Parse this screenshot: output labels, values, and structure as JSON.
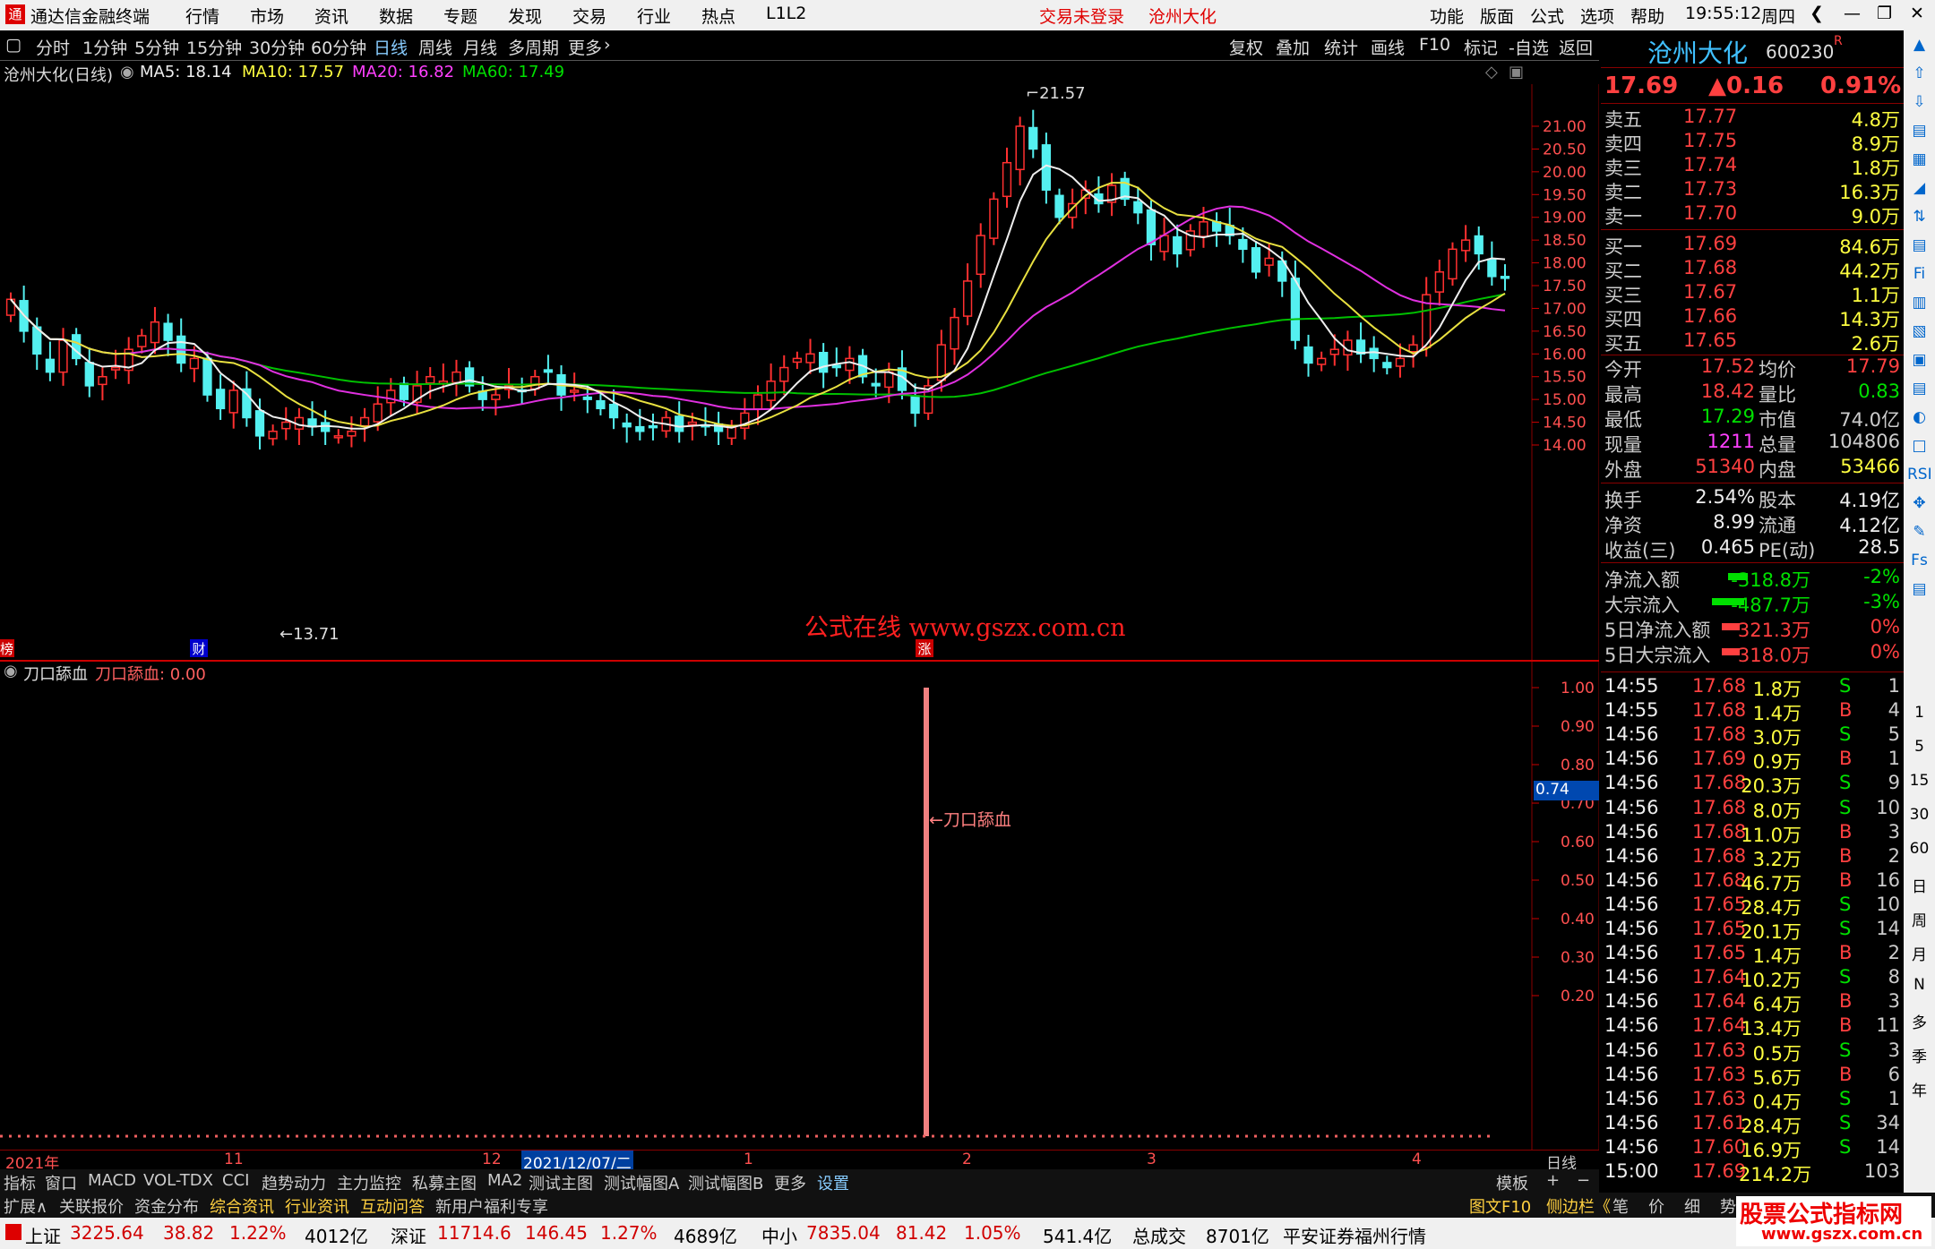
{
  "titlebar": {
    "app": "通达信金融终端",
    "menu": [
      "行情",
      "市场",
      "资讯",
      "数据",
      "专题",
      "发现",
      "交易",
      "行业",
      "热点",
      "L1L2"
    ],
    "login": "交易未登录",
    "stock": "沧州大化",
    "right_menu": [
      "功能",
      "版面",
      "公式",
      "选项",
      "帮助"
    ],
    "time": "19:55:12",
    "weekday": "周四"
  },
  "toolbar": {
    "periods": [
      "分时",
      "1分钟",
      "5分钟",
      "15分钟",
      "30分钟",
      "60分钟",
      "日线",
      "周线",
      "月线",
      "多周期",
      "更多"
    ],
    "selected": "日线",
    "actions": [
      "复权",
      "叠加",
      "统计",
      "画线",
      "F10",
      "标记",
      "-自选",
      "返回"
    ]
  },
  "infobar": {
    "title": "沧州大化(日线)",
    "ma5": "MA5: 18.14",
    "ma10": "MA10: 17.57",
    "ma20": "MA20: 16.82",
    "ma60": "MA60: 17.49"
  },
  "chart": {
    "high_label": "21.57",
    "low_label": "13.71",
    "watermark": "公式在线  www.gszx.com.cn",
    "mark_left": "榜",
    "mark_cai": "财",
    "mark_zhang": "涨",
    "y_ticks": [
      "21.00",
      "20.50",
      "20.00",
      "19.50",
      "19.00",
      "18.50",
      "18.00",
      "17.50",
      "17.00",
      "16.50",
      "16.00",
      "15.50",
      "15.00",
      "14.50",
      "14.00"
    ]
  },
  "chart_data": {
    "type": "candlestick",
    "ylim": [
      13.6,
      21.7
    ],
    "highest": 21.57,
    "lowest": 13.71,
    "ma": {
      "MA5": 18.14,
      "MA10": 17.57,
      "MA20": 16.82,
      "MA60": 17.49
    }
  },
  "subchart": {
    "title": "刀口舔血",
    "value_label": "刀口舔血: 0.00",
    "annotation": "←刀口舔血",
    "cursor_value": "0.74",
    "y_ticks": [
      "1.00",
      "0.90",
      "0.80",
      "0.70",
      "0.60",
      "0.50",
      "0.40",
      "0.30",
      "0.20"
    ],
    "signal_value": 1.0
  },
  "axis": {
    "labels": [
      "2021年",
      "11",
      "12",
      "2021/12/07/二",
      "1",
      "2",
      "3",
      "4"
    ],
    "period": "日线"
  },
  "tabs1": [
    "指标",
    "窗口",
    "MACD",
    "VOL-TDX",
    "CCI",
    "趋势动力",
    "主力监控",
    "私募主图",
    "MA2",
    "测试主图",
    "测试幅图A",
    "测试幅图B",
    "更多",
    "设置"
  ],
  "tabs1_right": [
    "模板",
    "+",
    "−"
  ],
  "tabs2": [
    "扩展∧",
    "关联报价",
    "资金分布",
    "综合资讯",
    "行业资讯",
    "互动问答",
    "新用户福利专享"
  ],
  "tabs2_right": [
    "图文F10",
    "侧边栏《",
    "笔",
    "价",
    "细",
    "势",
    "联"
  ],
  "status": {
    "sh": "上证",
    "sh_val": "3225.64",
    "sh_chg": "38.82",
    "sh_pct": "1.22%",
    "sh_amt": "4012亿",
    "sz": "深证",
    "sz_val": "11714.6",
    "sz_chg": "146.45",
    "sz_pct": "1.27%",
    "sz_amt": "4689亿",
    "zx": "中小",
    "zx_val": "7835.04",
    "zx_chg": "81.42",
    "zx_pct": "1.05%",
    "zx_amt": "541.4亿",
    "total": "总成交",
    "total_amt": "8701亿",
    "broker": "平安证券福州行情",
    "logo_text": "股票公式指标网",
    "logo_url": "www.gszx.com.cn"
  },
  "quote": {
    "name": "沧州大化",
    "code": "600230",
    "r": "R",
    "price": "17.69",
    "change": "▲0.16",
    "pct": "0.91%",
    "asks": [
      [
        "卖五",
        "17.77",
        "4.8万"
      ],
      [
        "卖四",
        "17.75",
        "8.9万"
      ],
      [
        "卖三",
        "17.74",
        "1.8万"
      ],
      [
        "卖二",
        "17.73",
        "16.3万"
      ],
      [
        "卖一",
        "17.70",
        "9.0万"
      ]
    ],
    "bids": [
      [
        "买一",
        "17.69",
        "84.6万"
      ],
      [
        "买二",
        "17.68",
        "44.2万"
      ],
      [
        "买三",
        "17.67",
        "1.1万"
      ],
      [
        "买四",
        "17.66",
        "14.3万"
      ],
      [
        "买五",
        "17.65",
        "2.6万"
      ]
    ],
    "stats": [
      [
        "今开",
        "17.52",
        "均价",
        "17.79"
      ],
      [
        "最高",
        "18.42",
        "量比",
        "0.83"
      ],
      [
        "最低",
        "17.29",
        "市值",
        "74.0亿"
      ],
      [
        "现量",
        "1211",
        "总量",
        "104806"
      ],
      [
        "外盘",
        "51340",
        "内盘",
        "53466"
      ]
    ],
    "stats2": [
      [
        "换手",
        "2.54%",
        "股本",
        "4.19亿"
      ],
      [
        "净资",
        "8.99",
        "流通",
        "4.12亿"
      ],
      [
        "收益(三)",
        "0.465",
        "PE(动)",
        "28.5"
      ]
    ],
    "flows": [
      [
        "净流入额",
        "-318.8万",
        "-2%"
      ],
      [
        "大宗流入",
        "-487.7万",
        "-3%"
      ],
      [
        "5日净流入额",
        "321.3万",
        "0%"
      ],
      [
        "5日大宗流入",
        "318.0万",
        "0%"
      ]
    ],
    "ticks": [
      [
        "14:55",
        "17.68",
        "1.8万",
        "S",
        "1"
      ],
      [
        "14:55",
        "17.68",
        "1.4万",
        "B",
        "4"
      ],
      [
        "14:56",
        "17.68",
        "3.0万",
        "S",
        "5"
      ],
      [
        "14:56",
        "17.69",
        "0.9万",
        "B",
        "1"
      ],
      [
        "14:56",
        "17.68",
        "20.3万",
        "S",
        "9"
      ],
      [
        "14:56",
        "17.68",
        "8.0万",
        "S",
        "10"
      ],
      [
        "14:56",
        "17.68",
        "11.0万",
        "B",
        "3"
      ],
      [
        "14:56",
        "17.68",
        "3.2万",
        "B",
        "2"
      ],
      [
        "14:56",
        "17.68",
        "46.7万",
        "B",
        "16"
      ],
      [
        "14:56",
        "17.65",
        "28.4万",
        "S",
        "10"
      ],
      [
        "14:56",
        "17.65",
        "20.1万",
        "S",
        "14"
      ],
      [
        "14:56",
        "17.65",
        "1.4万",
        "B",
        "2"
      ],
      [
        "14:56",
        "17.64",
        "10.2万",
        "S",
        "8"
      ],
      [
        "14:56",
        "17.64",
        "6.4万",
        "B",
        "3"
      ],
      [
        "14:56",
        "17.64",
        "13.4万",
        "B",
        "11"
      ],
      [
        "14:56",
        "17.63",
        "0.5万",
        "S",
        "3"
      ],
      [
        "14:56",
        "17.63",
        "5.6万",
        "B",
        "6"
      ],
      [
        "14:56",
        "17.63",
        "0.4万",
        "S",
        "1"
      ],
      [
        "14:56",
        "17.61",
        "28.4万",
        "S",
        "34"
      ],
      [
        "14:56",
        "17.60",
        "16.9万",
        "S",
        "14"
      ],
      [
        "15:00",
        "17.69",
        "214.2万",
        "",
        "103"
      ]
    ]
  },
  "side_icons": [
    "1",
    "5",
    "15",
    "30",
    "60",
    "日",
    "周",
    "月",
    "N",
    "多",
    "季",
    "年"
  ]
}
